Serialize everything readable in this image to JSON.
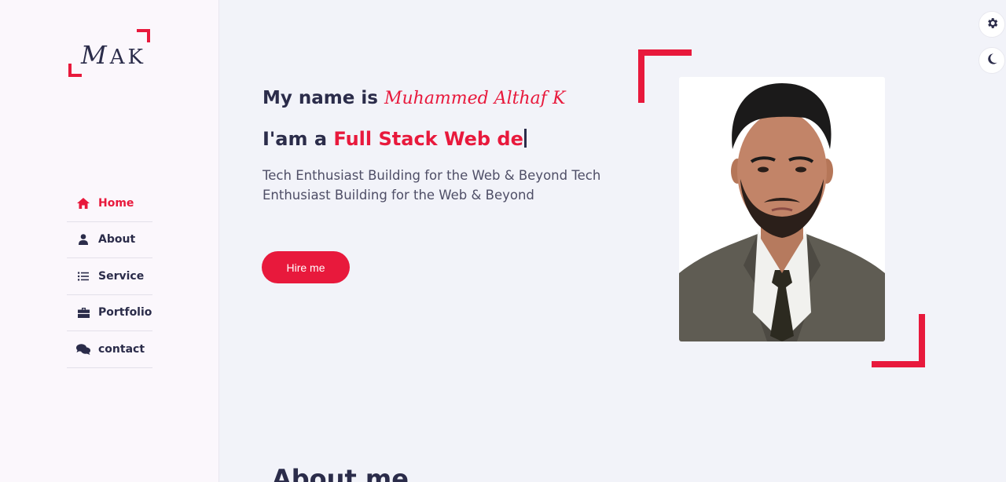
{
  "logo": {
    "first": "M",
    "rest": "AK"
  },
  "nav": {
    "items": [
      {
        "label": "Home",
        "icon": "home-icon",
        "active": true
      },
      {
        "label": "About",
        "icon": "user-icon",
        "active": false
      },
      {
        "label": "Service",
        "icon": "list-icon",
        "active": false
      },
      {
        "label": "Portfolio",
        "icon": "briefcase-icon",
        "active": false
      },
      {
        "label": "contact",
        "icon": "chat-icon",
        "active": false
      }
    ]
  },
  "hero": {
    "intro": "My name is",
    "name": "Muhammed Althaf K",
    "role_prefix": "I'am a",
    "role_typed": "Full Stack Web de",
    "description": "Tech Enthusiast Building for the Web & Beyond Tech Enthusiast Building for the Web & Beyond",
    "hire_label": "Hire me"
  },
  "controls": {
    "settings_icon": "gear-icon",
    "theme_icon": "moon-icon"
  },
  "about": {
    "heading": "About me"
  },
  "colors": {
    "accent": "#e8193c",
    "text": "#2b2c4a",
    "sidebar_bg": "#fbf7fc",
    "main_bg": "#f2f3f9"
  }
}
